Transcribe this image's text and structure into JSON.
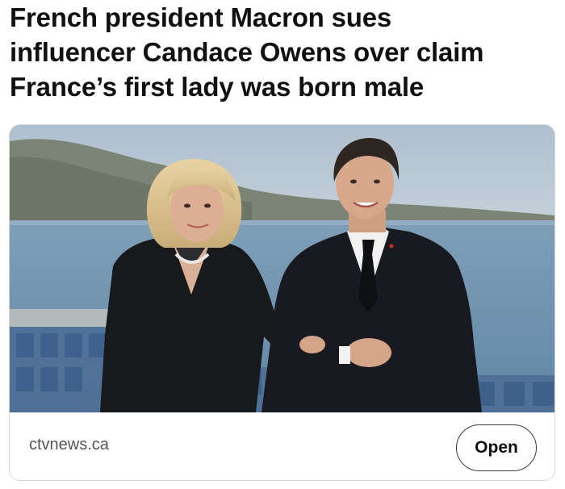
{
  "headline": {
    "line1": "French president Macron sues",
    "line2": "influencer Candace Owens over claim",
    "line3": "France’s first lady was born male"
  },
  "link_card": {
    "image": "news-photo",
    "source": "ctvnews.ca",
    "open_label": "Open"
  }
}
